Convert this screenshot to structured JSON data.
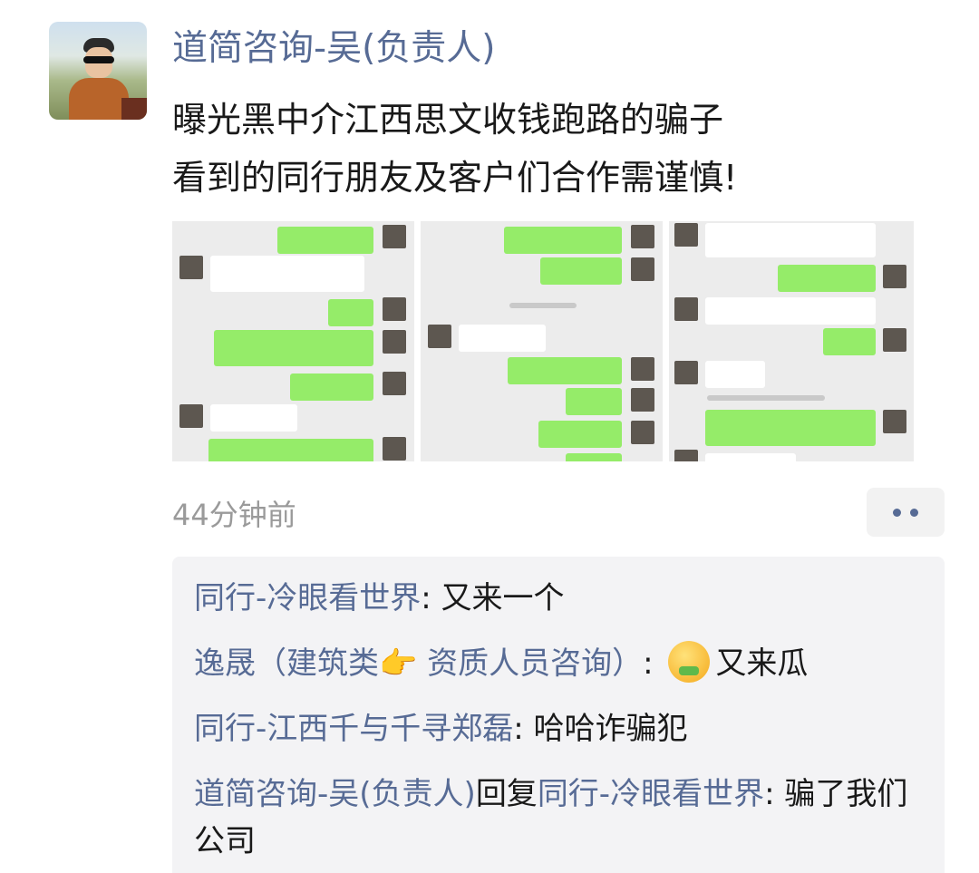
{
  "post": {
    "author": "道简咨询-吴(负责人)",
    "text_lines": [
      "曝光黑中介江西思文收钱跑路的骗子",
      "看到的同行朋友及客户们合作需谨慎!"
    ],
    "time": "44分钟前"
  },
  "icons": {
    "avatar": "avatar-photo",
    "more": "more-dots-icon",
    "emoji": "melon-eating-emoji"
  },
  "comments": [
    {
      "author": "同行-冷眼看世界",
      "sep": ": ",
      "text": "又来一个"
    },
    {
      "author": "逸晟（建筑类👉 资质人员咨询）",
      "sep": ": ",
      "text": "又来瓜"
    },
    {
      "author": "同行-江西千与千寻郑磊",
      "sep": ": ",
      "text": "哈哈诈骗犯"
    },
    {
      "author": "道简咨询-吴(负责人)",
      "reply_word": "回复",
      "reply_to": "同行-冷眼看世界",
      "sep": ": ",
      "text": "骗了我们公司"
    }
  ],
  "colors": {
    "link": "#576b95",
    "text": "#191919",
    "time": "#9a9a9a",
    "bubble_green": "#95ec69"
  }
}
